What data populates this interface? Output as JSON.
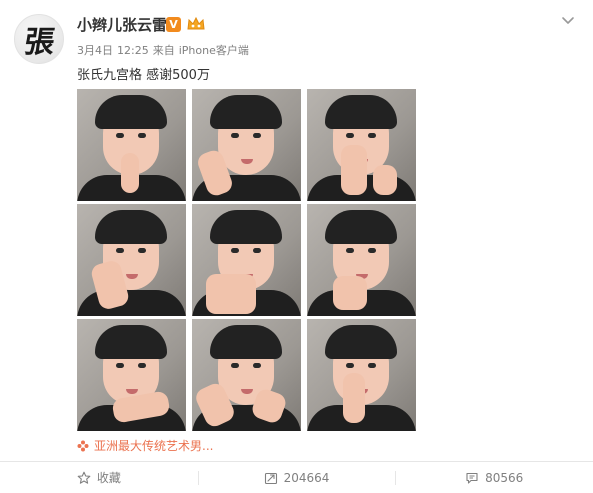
{
  "post": {
    "author": {
      "name": "小辫儿张云雷",
      "avatar_glyph": "張",
      "vip_badge": "V"
    },
    "meta": {
      "date": "3月4日",
      "time": "12:25",
      "source_prefix": "来自",
      "source": "iPhone客户端"
    },
    "text": "张氏九宫格 感谢500万",
    "photo_count": 9,
    "tag_link": "亚洲最大传统艺术男..."
  },
  "actions": {
    "favorite_label": "收藏",
    "repost_count": "204664",
    "comment_count": "80566"
  },
  "colors": {
    "accent_link": "#eb7350",
    "vip_orange": "#f28b1e",
    "meta_gray": "#808080"
  },
  "icons": {
    "menu": "chevron-down-icon",
    "favorite": "star-icon",
    "repost": "repost-icon",
    "comment": "comment-icon",
    "tag": "flower-icon"
  }
}
